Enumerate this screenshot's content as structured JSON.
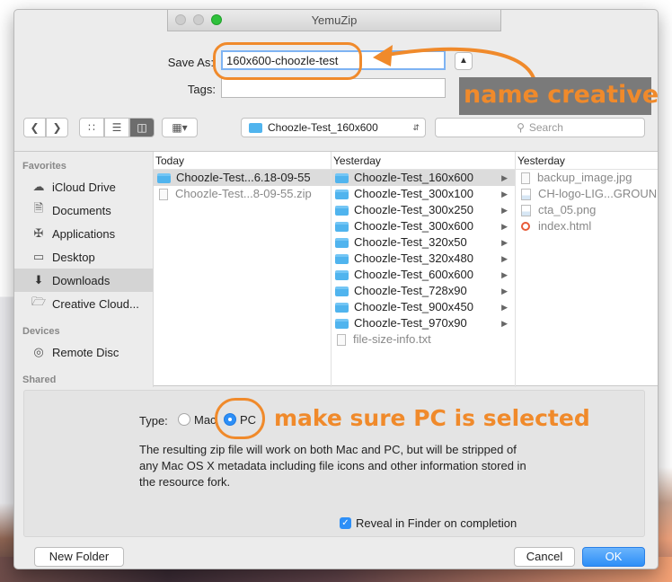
{
  "window": {
    "title": "YemuZip"
  },
  "save_as": {
    "label": "Save As:",
    "value": "160x600-choozle-test",
    "tags_label": "Tags:",
    "tags_value": "",
    "expand_icon": "chevron-up-icon"
  },
  "toolbar": {
    "view_icons": [
      "icon-grid-icon",
      "list-icon",
      "columns-icon",
      "gallery-icon"
    ],
    "location": "Choozle-Test_160x600",
    "search_placeholder": "Search"
  },
  "sidebar": {
    "favorites_title": "Favorites",
    "favorites": [
      {
        "label": "iCloud Drive",
        "icon": "cloud-icon"
      },
      {
        "label": "Documents",
        "icon": "document-icon"
      },
      {
        "label": "Applications",
        "icon": "applications-icon"
      },
      {
        "label": "Desktop",
        "icon": "desktop-icon"
      },
      {
        "label": "Downloads",
        "icon": "download-icon",
        "selected": true
      },
      {
        "label": "Creative Cloud...",
        "icon": "folder-icon"
      }
    ],
    "devices_title": "Devices",
    "devices": [
      {
        "label": "Remote Disc",
        "icon": "disc-icon"
      }
    ],
    "shared_title": "Shared"
  },
  "columns": [
    {
      "header": "Today",
      "items": [
        {
          "name": "Choozle-Test...6.18-09-55",
          "kind": "folder",
          "selected": true
        },
        {
          "name": "Choozle-Test...8-09-55.zip",
          "kind": "zip",
          "dim": true
        }
      ]
    },
    {
      "header": "Yesterday",
      "items": [
        {
          "name": "Choozle-Test_160x600",
          "kind": "folder",
          "selected": true
        },
        {
          "name": "Choozle-Test_300x100",
          "kind": "folder"
        },
        {
          "name": "Choozle-Test_300x250",
          "kind": "folder"
        },
        {
          "name": "Choozle-Test_300x600",
          "kind": "folder"
        },
        {
          "name": "Choozle-Test_320x50",
          "kind": "folder"
        },
        {
          "name": "Choozle-Test_320x480",
          "kind": "folder"
        },
        {
          "name": "Choozle-Test_600x600",
          "kind": "folder"
        },
        {
          "name": "Choozle-Test_728x90",
          "kind": "folder"
        },
        {
          "name": "Choozle-Test_900x450",
          "kind": "folder"
        },
        {
          "name": "Choozle-Test_970x90",
          "kind": "folder"
        },
        {
          "name": "file-size-info.txt",
          "kind": "doc",
          "dim": true
        }
      ]
    },
    {
      "header": "Yesterday",
      "items": [
        {
          "name": "backup_image.jpg",
          "kind": "doc",
          "dim": true
        },
        {
          "name": "CH-logo-LIG...GROUND",
          "kind": "img",
          "dim": true
        },
        {
          "name": "cta_05.png",
          "kind": "img",
          "dim": true
        },
        {
          "name": "index.html",
          "kind": "html",
          "dim": true
        }
      ]
    }
  ],
  "options": {
    "type_label": "Type:",
    "mac_label": "Mac",
    "pc_label": "PC",
    "selected": "PC",
    "description": "The resulting zip file will work on both Mac and PC, but will be stripped of any Mac OS X metadata including file icons and other information stored in the resource fork.",
    "reveal_label": "Reveal in Finder on completion",
    "reveal_checked": true
  },
  "buttons": {
    "new_folder": "New Folder",
    "cancel": "Cancel",
    "ok": "OK"
  },
  "annotations": {
    "name_creative": "name creative",
    "pc_note": "make sure PC is selected",
    "color": "#f08a2b"
  }
}
